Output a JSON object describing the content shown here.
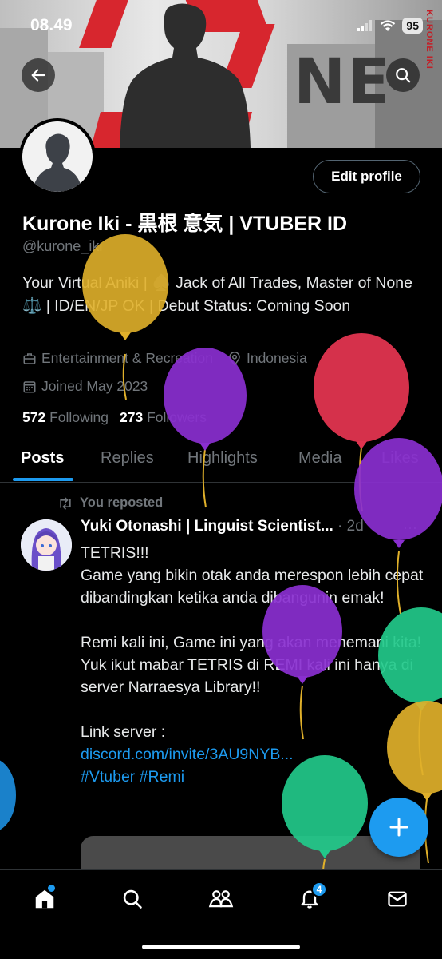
{
  "status_bar": {
    "time": "08.49",
    "battery": "95"
  },
  "banner": {
    "brand_text": "KURONE IKI",
    "art_text": "NE"
  },
  "profile": {
    "display_name": "Kurone Iki - 黒根 意気 | VTUBER ID",
    "handle": "@kurone_iki",
    "edit_button": "Edit profile",
    "bio": "Your Virtual Aniki | ♠️ Jack of All Trades, Master of None ⚖️ | ID/EN/JP OK | Debut Status: Coming Soon",
    "category": "Entertainment & Recreation",
    "location": "Indonesia",
    "joined": "Joined May 2023",
    "following_count": "572",
    "following_label": "Following",
    "followers_count": "273",
    "followers_label": "Followers"
  },
  "tabs": [
    {
      "label": "Posts"
    },
    {
      "label": "Replies"
    },
    {
      "label": "Highlights"
    },
    {
      "label": "Media"
    },
    {
      "label": "Likes"
    }
  ],
  "post": {
    "repost_label": "You reposted",
    "author": "Yuki Otonashi | Linguist Scientist...",
    "time": "· 2d",
    "more": "···",
    "text_lines": "TETRIS!!!\nGame yang bikin otak anda merespon lebih cepat dibandingkan ketika anda dibangunin emak!\n\nRemi kali ini, Game ini yang akan menemani kita!\nYuk ikut mabar TETRIS di REMI kali ini hanya di server Narraesya Library!!\n\nLink server :",
    "link": "discord.com/invite/3AU9NYB...",
    "hashtags": "#Vtuber #Remi"
  },
  "bottom_nav": {
    "notifications_badge": "4"
  },
  "colors": {
    "accent": "#1d9bf0",
    "background": "#000000",
    "muted": "#71767b",
    "banner_red": "#d7262e"
  },
  "icons": [
    "back-arrow-icon",
    "search-icon",
    "briefcase-icon",
    "location-pin-icon",
    "calendar-icon",
    "repost-icon",
    "plus-icon",
    "home-icon",
    "explore-icon",
    "communities-icon",
    "bell-icon",
    "mail-icon",
    "balloon-icon"
  ]
}
